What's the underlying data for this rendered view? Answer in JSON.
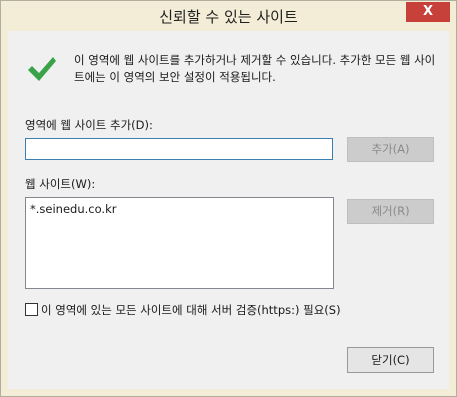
{
  "window": {
    "title": "신뢰할 수 있는 사이트",
    "close_glyph": "X"
  },
  "info": {
    "text": "이 영역에 웹 사이트를 추가하거나 제거할 수 있습니다. 추가한 모든 웹 사이트에는 이 영역의 보안 설정이 적용됩니다."
  },
  "add_section": {
    "label": "영역에 웹 사이트 추가(D):",
    "input_value": "",
    "add_button": "추가(A)"
  },
  "list_section": {
    "label": "웹 사이트(W):",
    "sites": [
      "*.seinedu.co.kr"
    ],
    "remove_button": "제거(R)"
  },
  "https_option": {
    "label": "이 영역에 있는 모든 사이트에 대해 서버 검증(https:) 필요(S)",
    "checked": false
  },
  "footer": {
    "close_button": "닫기(C)"
  },
  "colors": {
    "frame": "#f3edd7",
    "close_button": "#c7403a",
    "check_icon": "#3aa34a",
    "input_border": "#3c7fb1"
  }
}
